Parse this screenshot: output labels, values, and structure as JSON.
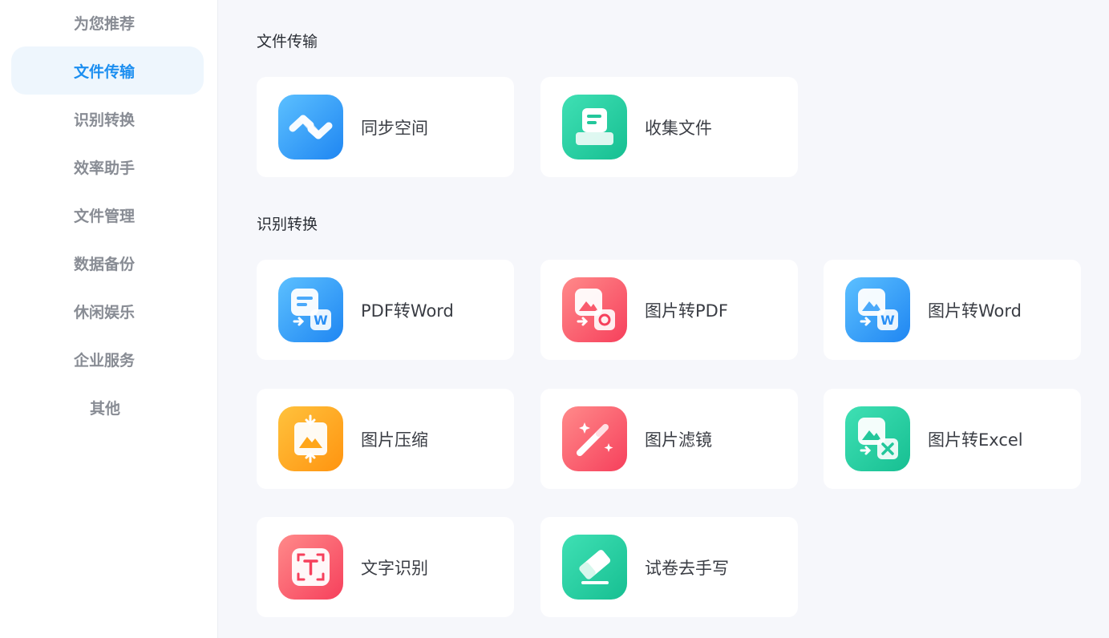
{
  "sidebar": {
    "items": [
      {
        "label": "为您推荐",
        "active": false
      },
      {
        "label": "文件传输",
        "active": true
      },
      {
        "label": "识别转换",
        "active": false
      },
      {
        "label": "效率助手",
        "active": false
      },
      {
        "label": "文件管理",
        "active": false
      },
      {
        "label": "数据备份",
        "active": false
      },
      {
        "label": "休闲娱乐",
        "active": false
      },
      {
        "label": "企业服务",
        "active": false
      },
      {
        "label": "其他",
        "active": false
      }
    ]
  },
  "sections": [
    {
      "title": "文件传输",
      "tools": [
        {
          "label": "同步空间",
          "icon": "sync-space-icon"
        },
        {
          "label": "收集文件",
          "icon": "collect-files-icon"
        }
      ]
    },
    {
      "title": "识别转换",
      "tools": [
        {
          "label": "PDF转Word",
          "icon": "pdf-to-word-icon"
        },
        {
          "label": "图片转PDF",
          "icon": "image-to-pdf-icon"
        },
        {
          "label": "图片转Word",
          "icon": "image-to-word-icon"
        },
        {
          "label": "图片压缩",
          "icon": "image-compress-icon"
        },
        {
          "label": "图片滤镜",
          "icon": "image-filter-icon"
        },
        {
          "label": "图片转Excel",
          "icon": "image-to-excel-icon"
        },
        {
          "label": "文字识别",
          "icon": "text-ocr-icon"
        },
        {
          "label": "试卷去手写",
          "icon": "remove-handwriting-icon"
        }
      ]
    }
  ],
  "colors": {
    "accent": "#1b8ef0",
    "active_bg": "#eef6fd",
    "blue": "#2a8ff5",
    "green": "#23c79b",
    "red": "#fa5a6d",
    "orange": "#ffa61a"
  }
}
